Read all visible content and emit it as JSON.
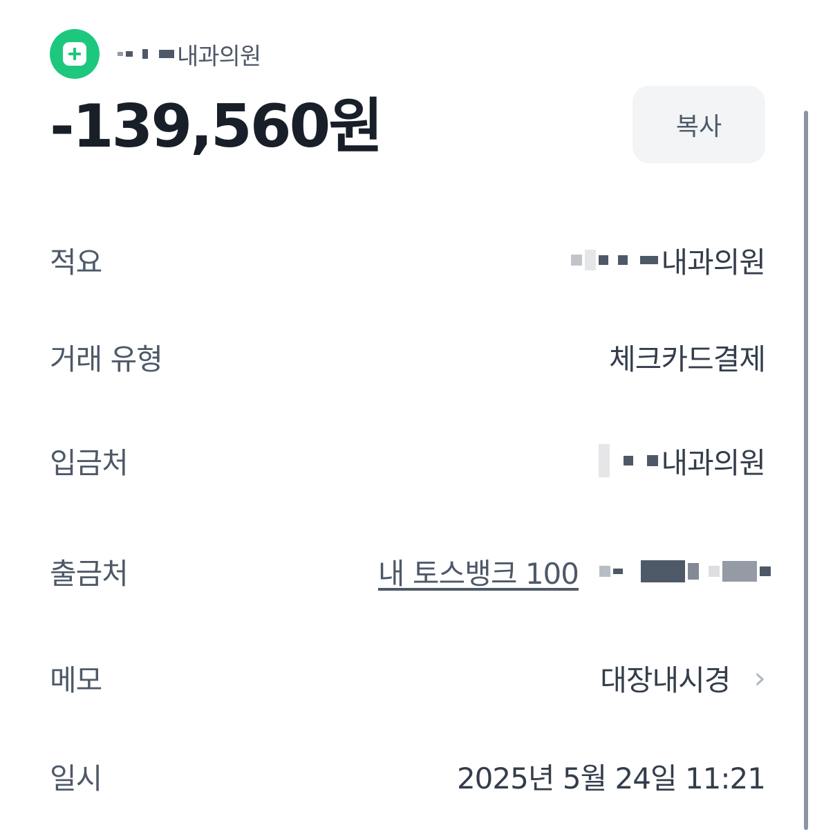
{
  "header": {
    "merchant_icon": "plus-hospital-icon",
    "merchant_name": "내과의원",
    "brand_color": "#1dc87e"
  },
  "amount": "-139,560원",
  "copy_button": "복사",
  "details": {
    "memo_summary": {
      "label": "적요",
      "value": "내과의원"
    },
    "transaction_type": {
      "label": "거래 유형",
      "value": "체크카드결제"
    },
    "recipient": {
      "label": "입금처",
      "value": "내과의원"
    },
    "withdrawal": {
      "label": "출금처",
      "value": "내 토스뱅크 100"
    },
    "memo": {
      "label": "메모",
      "value": "대장내시경"
    },
    "datetime": {
      "label": "일시",
      "value": "2025년 5월 24일 11:21"
    }
  }
}
